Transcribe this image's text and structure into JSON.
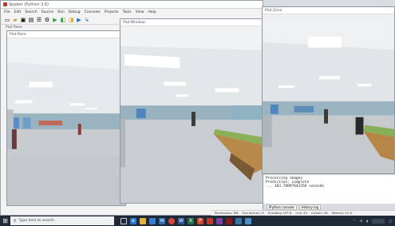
{
  "ide": {
    "title": "Spyder (Python 3.6)",
    "menu": [
      "File",
      "Edit",
      "Search",
      "Source",
      "Run",
      "Debug",
      "Consoles",
      "Projects",
      "Tools",
      "View",
      "Help"
    ],
    "pane_label": "Plot Pane"
  },
  "windows": [
    {
      "title": "Plot Pane"
    },
    {
      "title": "Plot Window"
    },
    {
      "title": "Plot Zone"
    }
  ],
  "console": {
    "tabs": [
      "IPython console",
      "History log"
    ],
    "lines": [
      "Processing images",
      "Prediction: complete",
      "... 183.78897643256 seconds"
    ]
  },
  "statusbar": {
    "permissions": "Permissions: RW",
    "eol": "End-of-lines: LF",
    "encoding": "Encoding: UTF-8",
    "line": "Line: 49",
    "column": "Column: 26",
    "memory": "Memory: 54 %"
  },
  "taskbar": {
    "search_placeholder": "Type here to search"
  },
  "colors": {
    "taskbar": "#1f2a36",
    "ceiling": "#e9ecef",
    "floor": "#c9ccd0"
  }
}
